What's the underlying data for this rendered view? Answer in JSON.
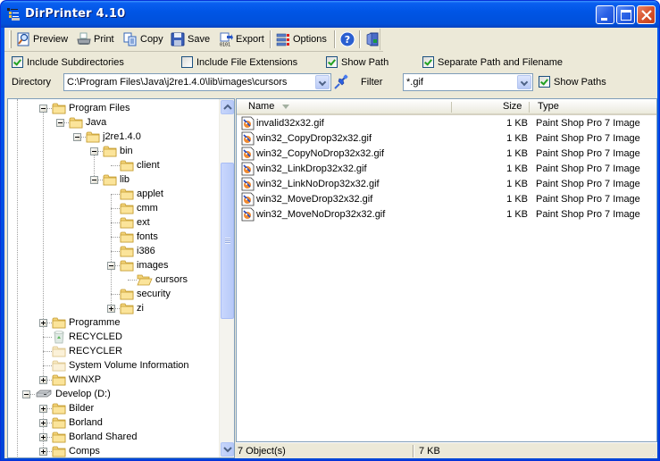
{
  "window": {
    "title": "DirPrinter 4.10",
    "controls": {
      "minimize": "minimize-icon",
      "maximize": "maximize-icon",
      "close": "close-icon"
    }
  },
  "toolbar": {
    "buttons": [
      {
        "label": "Preview",
        "icon": "preview-magnifier-icon"
      },
      {
        "label": "Print",
        "icon": "printer-icon"
      },
      {
        "label": "Copy",
        "icon": "copy-icon"
      },
      {
        "label": "Save",
        "icon": "floppy-disk-icon"
      },
      {
        "label": "Export",
        "icon": "export-icon"
      },
      {
        "label": "Options",
        "icon": "options-list-icon"
      },
      {
        "label": "",
        "icon": "help-icon"
      },
      {
        "label": "",
        "icon": "exit-door-icon"
      }
    ]
  },
  "options": {
    "include_subdirectories": {
      "label": "Include Subdirectories",
      "checked": true
    },
    "include_file_extensions": {
      "label": "Include File Extensions",
      "checked": false
    },
    "show_path": {
      "label": "Show Path",
      "checked": true
    },
    "separate_path_filename": {
      "label": "Separate Path and Filename",
      "checked": true
    },
    "show_paths": {
      "label": "Show Paths",
      "checked": true
    }
  },
  "directory": {
    "label": "Directory",
    "value": "C:\\Program Files\\Java\\j2re1.4.0\\lib\\images\\cursors",
    "pin_icon": "pushpin-icon"
  },
  "filter": {
    "label": "Filter",
    "value": "*.gif"
  },
  "tree": {
    "items": [
      {
        "label": "Program Files",
        "level": 2,
        "expander": "minus",
        "icon": "folder"
      },
      {
        "label": "Java",
        "level": 3,
        "expander": "minus",
        "icon": "folder"
      },
      {
        "label": "j2re1.4.0",
        "level": 4,
        "expander": "minus",
        "icon": "folder"
      },
      {
        "label": "bin",
        "level": 5,
        "expander": "minus",
        "icon": "folder"
      },
      {
        "label": "client",
        "level": 6,
        "expander": "",
        "icon": "folder"
      },
      {
        "label": "lib",
        "level": 5,
        "expander": "minus",
        "icon": "folder"
      },
      {
        "label": "applet",
        "level": 6,
        "expander": "",
        "icon": "folder"
      },
      {
        "label": "cmm",
        "level": 6,
        "expander": "",
        "icon": "folder"
      },
      {
        "label": "ext",
        "level": 6,
        "expander": "",
        "icon": "folder"
      },
      {
        "label": "fonts",
        "level": 6,
        "expander": "",
        "icon": "folder"
      },
      {
        "label": "i386",
        "level": 6,
        "expander": "",
        "icon": "folder"
      },
      {
        "label": "images",
        "level": 6,
        "expander": "minus",
        "icon": "folder"
      },
      {
        "label": "cursors",
        "level": 7,
        "expander": "",
        "icon": "folder-open"
      },
      {
        "label": "security",
        "level": 6,
        "expander": "",
        "icon": "folder"
      },
      {
        "label": "zi",
        "level": 6,
        "expander": "plus",
        "icon": "folder"
      },
      {
        "label": "Programme",
        "level": 2,
        "expander": "plus",
        "icon": "folder"
      },
      {
        "label": "RECYCLED",
        "level": 2,
        "expander": "",
        "icon": "recycle-bin"
      },
      {
        "label": "RECYCLER",
        "level": 2,
        "expander": "",
        "icon": "folder-hidden"
      },
      {
        "label": "System Volume Information",
        "level": 2,
        "expander": "",
        "icon": "folder-hidden"
      },
      {
        "label": "WINXP",
        "level": 2,
        "expander": "plus",
        "icon": "folder"
      },
      {
        "label": "Develop (D:)",
        "level": 1,
        "expander": "minus",
        "icon": "drive"
      },
      {
        "label": "Bilder",
        "level": 2,
        "expander": "plus",
        "icon": "folder"
      },
      {
        "label": "Borland",
        "level": 2,
        "expander": "plus",
        "icon": "folder"
      },
      {
        "label": "Borland Shared",
        "level": 2,
        "expander": "plus",
        "icon": "folder"
      },
      {
        "label": "Comps",
        "level": 2,
        "expander": "plus",
        "icon": "folder"
      }
    ]
  },
  "list": {
    "columns": {
      "name": "Name",
      "size": "Size",
      "type": "Type"
    },
    "rows": [
      {
        "name": "invalid32x32.gif",
        "size": "1 KB",
        "type": "Paint Shop Pro 7 Image"
      },
      {
        "name": "win32_CopyDrop32x32.gif",
        "size": "1 KB",
        "type": "Paint Shop Pro 7 Image"
      },
      {
        "name": "win32_CopyNoDrop32x32.gif",
        "size": "1 KB",
        "type": "Paint Shop Pro 7 Image"
      },
      {
        "name": "win32_LinkDrop32x32.gif",
        "size": "1 KB",
        "type": "Paint Shop Pro 7 Image"
      },
      {
        "name": "win32_LinkNoDrop32x32.gif",
        "size": "1 KB",
        "type": "Paint Shop Pro 7 Image"
      },
      {
        "name": "win32_MoveDrop32x32.gif",
        "size": "1 KB",
        "type": "Paint Shop Pro 7 Image"
      },
      {
        "name": "win32_MoveNoDrop32x32.gif",
        "size": "1 KB",
        "type": "Paint Shop Pro 7 Image"
      }
    ]
  },
  "status": {
    "objects": "7 Object(s)",
    "total_size": "7 KB"
  }
}
